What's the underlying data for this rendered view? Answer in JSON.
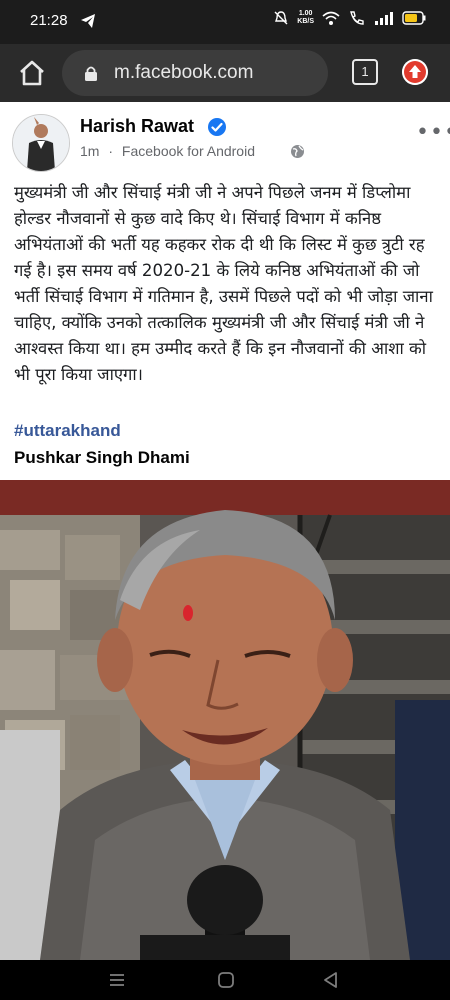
{
  "status_bar": {
    "time": "21:28",
    "net_speed_value": "1.00",
    "net_speed_unit": "KB/S"
  },
  "browser": {
    "url": "m.facebook.com",
    "tab_count": "1"
  },
  "post": {
    "author": "Harish Rawat",
    "time_ago": "1m",
    "separator": "·",
    "source": "Facebook for Android",
    "body": "मुख्यमंत्री जी और सिंचाई मंत्री जी ने अपने पिछले जनम में डिप्लोमा होल्डर नौजवानों से कुछ वादे किए थे। सिंचाई विभाग में कनिष्ठ अभियंताओं की भर्ती यह कहकर रोक दी थी कि लिस्ट में कुछ त्रुटी रह गई है। इस समय वर्ष 2020-21 के लिये कनिष्ठ अभियंताओं की जो भर्ती सिंचाई विभाग में गतिमान है, उसमें पिछले पदों को भी जोड़ा जाना चाहिए, क्योंकि उनको तत्कालिक मुख्यमंत्री जी और सिंचाई मंत्री जी ने आश्वस्त किया था। हम उम्मीद करते हैं कि इन नौजवानों की आशा को भी पूरा किया जाएगा।",
    "hashtag": "#uttarakhand",
    "tagged": "Pushkar Singh Dhami"
  }
}
